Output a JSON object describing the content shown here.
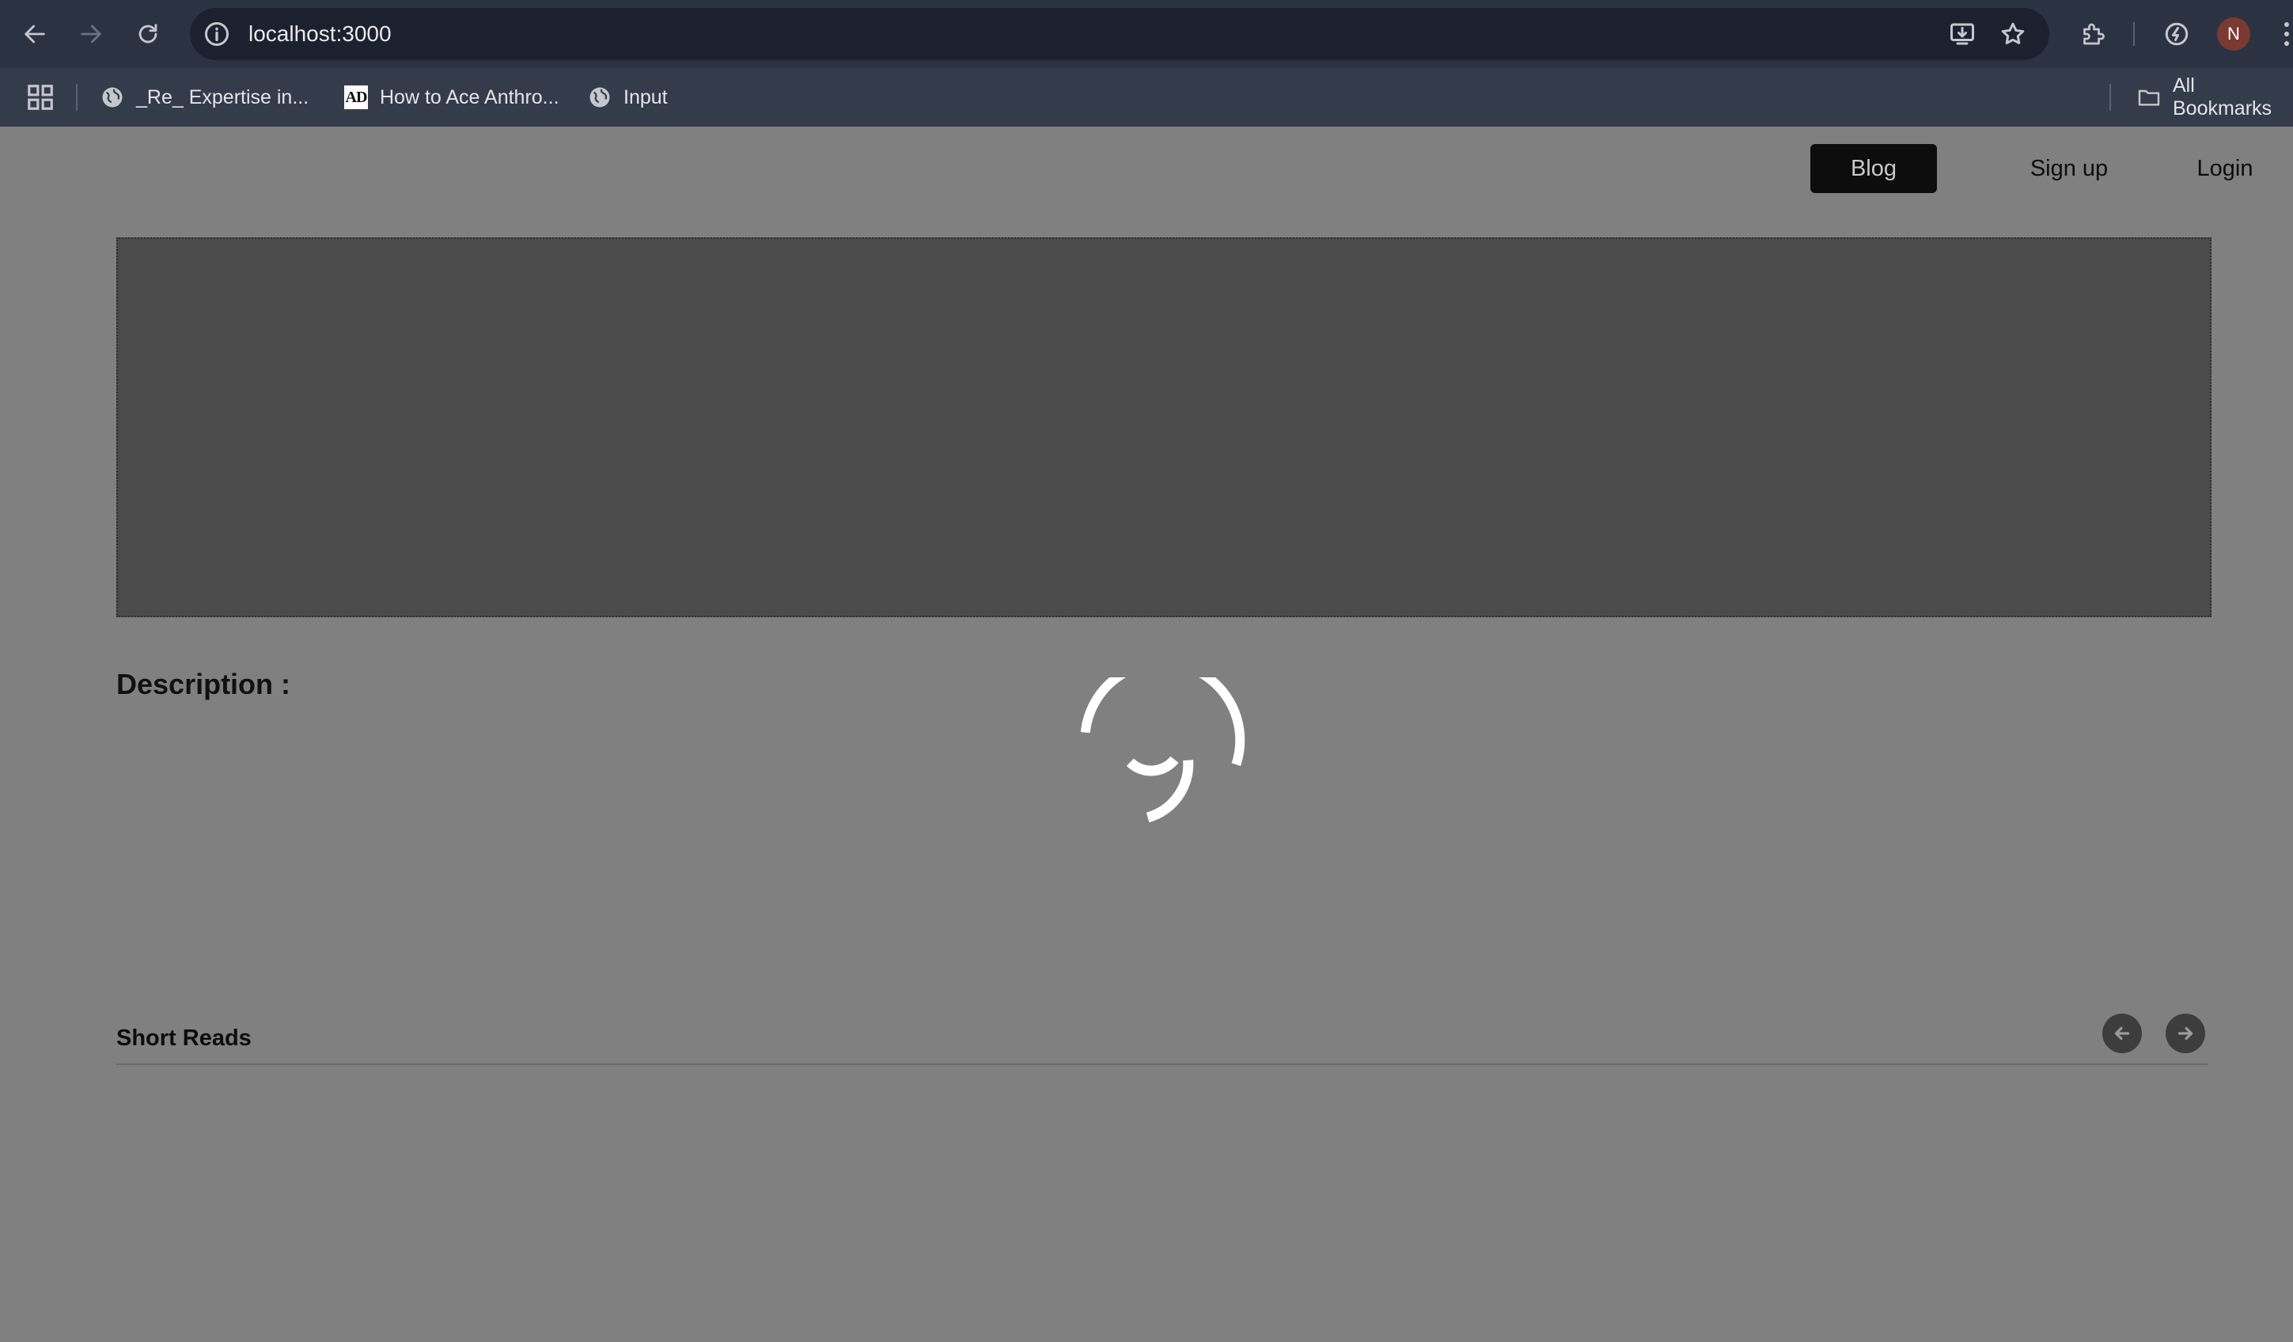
{
  "browser": {
    "url": "localhost:3000",
    "profile_initial": "N",
    "bookmarks": [
      {
        "label": "_Re_ Expertise in...",
        "icon": "globe-icon"
      },
      {
        "label": "How to Ace Anthro...",
        "icon": "ad-favicon"
      },
      {
        "label": "Input",
        "icon": "globe-icon"
      }
    ],
    "ad_favicon_text": "AD",
    "all_bookmarks_label": "All Bookmarks"
  },
  "site": {
    "nav": {
      "blog": "Blog",
      "signup": "Sign up",
      "login": "Login"
    },
    "description_heading": "Description :",
    "short_reads_heading": "Short Reads"
  },
  "colors": {
    "overlay": "#808080",
    "banner": "#4b4b4b",
    "toolbar": "#2b3342",
    "bookmark_bar": "#343c4b"
  }
}
